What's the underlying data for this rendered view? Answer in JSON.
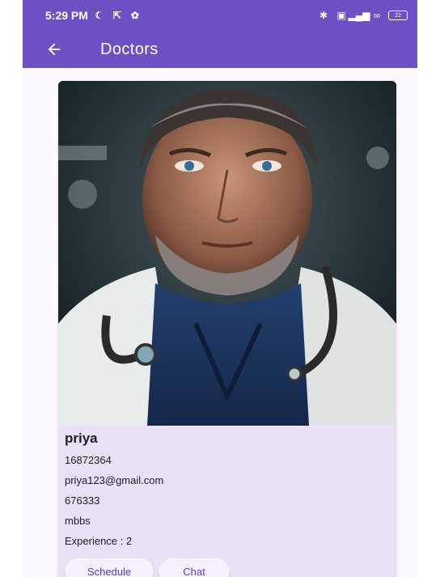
{
  "status_bar": {
    "time": "5:29 PM",
    "battery": "22"
  },
  "app_bar": {
    "title": "Doctors"
  },
  "doctor": {
    "name": "priya",
    "id": "16872364",
    "email": "priya123@gmail.com",
    "phone": "676333",
    "qualification": "mbbs",
    "experience": "Experience : 2"
  },
  "actions": {
    "schedule_label": "Schedule",
    "chat_label": "Chat"
  },
  "colors": {
    "primary": "#6e4fc4",
    "card": "#e9e2f7",
    "button_text": "#5c3fb8"
  }
}
